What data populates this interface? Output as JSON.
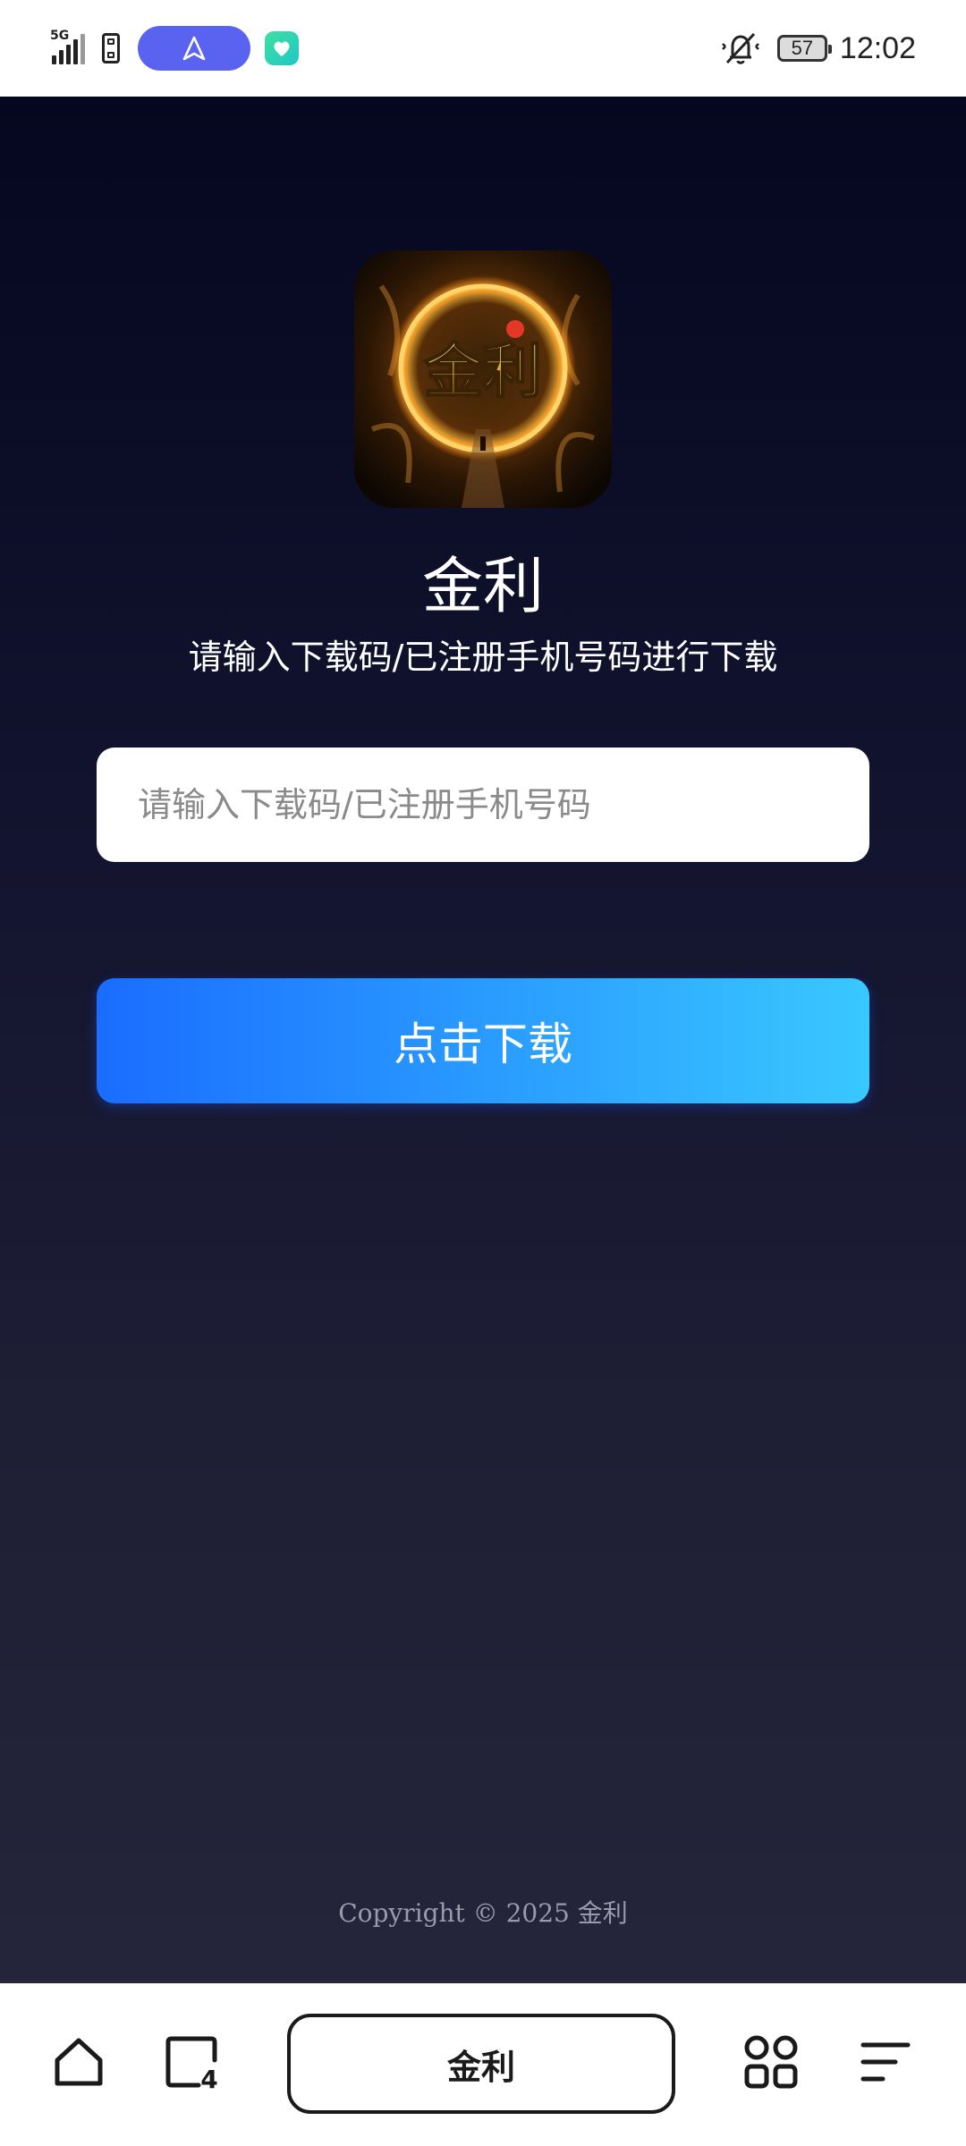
{
  "status_bar": {
    "network_label": "5G",
    "battery_level": "57",
    "time": "12:02",
    "icons": [
      "signal-5g-icon",
      "sim-card-icon",
      "navigation-arrow-icon",
      "app-notification-icon",
      "muted-bell-icon",
      "battery-icon"
    ]
  },
  "page": {
    "app_name": "金利",
    "subtitle": "请输入下载码/已注册手机号码进行下载",
    "input_placeholder": "请输入下载码/已注册手机号码",
    "input_value": "",
    "download_label": "点击下载",
    "copyright": "Copyright © 2025 金利",
    "logo_text": "金利",
    "colors": {
      "background_top": "#050720",
      "background_bottom": "#24243b",
      "button_start": "#1a6dff",
      "button_end": "#39c8ff"
    }
  },
  "browser_bar": {
    "page_title": "金利",
    "tab_count": "4",
    "icons": [
      "home-icon",
      "tabs-icon",
      "apps-grid-icon",
      "menu-icon"
    ]
  }
}
